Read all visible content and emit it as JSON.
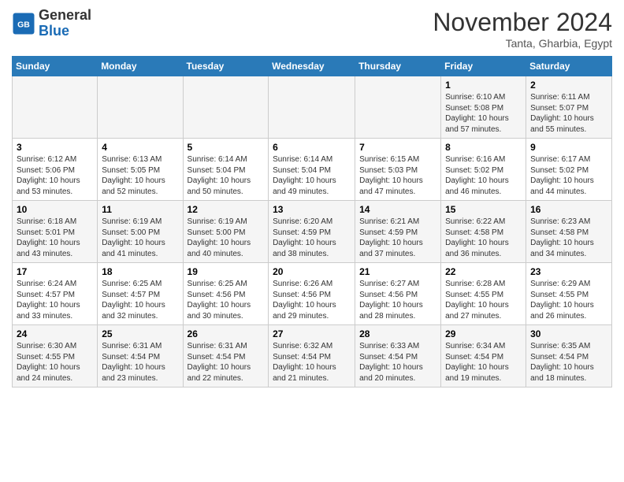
{
  "header": {
    "logo": {
      "general": "General",
      "blue": "Blue"
    },
    "month": "November 2024",
    "location": "Tanta, Gharbia, Egypt"
  },
  "weekdays": [
    "Sunday",
    "Monday",
    "Tuesday",
    "Wednesday",
    "Thursday",
    "Friday",
    "Saturday"
  ],
  "weeks": [
    [
      {
        "day": "",
        "info": ""
      },
      {
        "day": "",
        "info": ""
      },
      {
        "day": "",
        "info": ""
      },
      {
        "day": "",
        "info": ""
      },
      {
        "day": "",
        "info": ""
      },
      {
        "day": "1",
        "info": "Sunrise: 6:10 AM\nSunset: 5:08 PM\nDaylight: 10 hours and 57 minutes."
      },
      {
        "day": "2",
        "info": "Sunrise: 6:11 AM\nSunset: 5:07 PM\nDaylight: 10 hours and 55 minutes."
      }
    ],
    [
      {
        "day": "3",
        "info": "Sunrise: 6:12 AM\nSunset: 5:06 PM\nDaylight: 10 hours and 53 minutes."
      },
      {
        "day": "4",
        "info": "Sunrise: 6:13 AM\nSunset: 5:05 PM\nDaylight: 10 hours and 52 minutes."
      },
      {
        "day": "5",
        "info": "Sunrise: 6:14 AM\nSunset: 5:04 PM\nDaylight: 10 hours and 50 minutes."
      },
      {
        "day": "6",
        "info": "Sunrise: 6:14 AM\nSunset: 5:04 PM\nDaylight: 10 hours and 49 minutes."
      },
      {
        "day": "7",
        "info": "Sunrise: 6:15 AM\nSunset: 5:03 PM\nDaylight: 10 hours and 47 minutes."
      },
      {
        "day": "8",
        "info": "Sunrise: 6:16 AM\nSunset: 5:02 PM\nDaylight: 10 hours and 46 minutes."
      },
      {
        "day": "9",
        "info": "Sunrise: 6:17 AM\nSunset: 5:02 PM\nDaylight: 10 hours and 44 minutes."
      }
    ],
    [
      {
        "day": "10",
        "info": "Sunrise: 6:18 AM\nSunset: 5:01 PM\nDaylight: 10 hours and 43 minutes."
      },
      {
        "day": "11",
        "info": "Sunrise: 6:19 AM\nSunset: 5:00 PM\nDaylight: 10 hours and 41 minutes."
      },
      {
        "day": "12",
        "info": "Sunrise: 6:19 AM\nSunset: 5:00 PM\nDaylight: 10 hours and 40 minutes."
      },
      {
        "day": "13",
        "info": "Sunrise: 6:20 AM\nSunset: 4:59 PM\nDaylight: 10 hours and 38 minutes."
      },
      {
        "day": "14",
        "info": "Sunrise: 6:21 AM\nSunset: 4:59 PM\nDaylight: 10 hours and 37 minutes."
      },
      {
        "day": "15",
        "info": "Sunrise: 6:22 AM\nSunset: 4:58 PM\nDaylight: 10 hours and 36 minutes."
      },
      {
        "day": "16",
        "info": "Sunrise: 6:23 AM\nSunset: 4:58 PM\nDaylight: 10 hours and 34 minutes."
      }
    ],
    [
      {
        "day": "17",
        "info": "Sunrise: 6:24 AM\nSunset: 4:57 PM\nDaylight: 10 hours and 33 minutes."
      },
      {
        "day": "18",
        "info": "Sunrise: 6:25 AM\nSunset: 4:57 PM\nDaylight: 10 hours and 32 minutes."
      },
      {
        "day": "19",
        "info": "Sunrise: 6:25 AM\nSunset: 4:56 PM\nDaylight: 10 hours and 30 minutes."
      },
      {
        "day": "20",
        "info": "Sunrise: 6:26 AM\nSunset: 4:56 PM\nDaylight: 10 hours and 29 minutes."
      },
      {
        "day": "21",
        "info": "Sunrise: 6:27 AM\nSunset: 4:56 PM\nDaylight: 10 hours and 28 minutes."
      },
      {
        "day": "22",
        "info": "Sunrise: 6:28 AM\nSunset: 4:55 PM\nDaylight: 10 hours and 27 minutes."
      },
      {
        "day": "23",
        "info": "Sunrise: 6:29 AM\nSunset: 4:55 PM\nDaylight: 10 hours and 26 minutes."
      }
    ],
    [
      {
        "day": "24",
        "info": "Sunrise: 6:30 AM\nSunset: 4:55 PM\nDaylight: 10 hours and 24 minutes."
      },
      {
        "day": "25",
        "info": "Sunrise: 6:31 AM\nSunset: 4:54 PM\nDaylight: 10 hours and 23 minutes."
      },
      {
        "day": "26",
        "info": "Sunrise: 6:31 AM\nSunset: 4:54 PM\nDaylight: 10 hours and 22 minutes."
      },
      {
        "day": "27",
        "info": "Sunrise: 6:32 AM\nSunset: 4:54 PM\nDaylight: 10 hours and 21 minutes."
      },
      {
        "day": "28",
        "info": "Sunrise: 6:33 AM\nSunset: 4:54 PM\nDaylight: 10 hours and 20 minutes."
      },
      {
        "day": "29",
        "info": "Sunrise: 6:34 AM\nSunset: 4:54 PM\nDaylight: 10 hours and 19 minutes."
      },
      {
        "day": "30",
        "info": "Sunrise: 6:35 AM\nSunset: 4:54 PM\nDaylight: 10 hours and 18 minutes."
      }
    ]
  ]
}
